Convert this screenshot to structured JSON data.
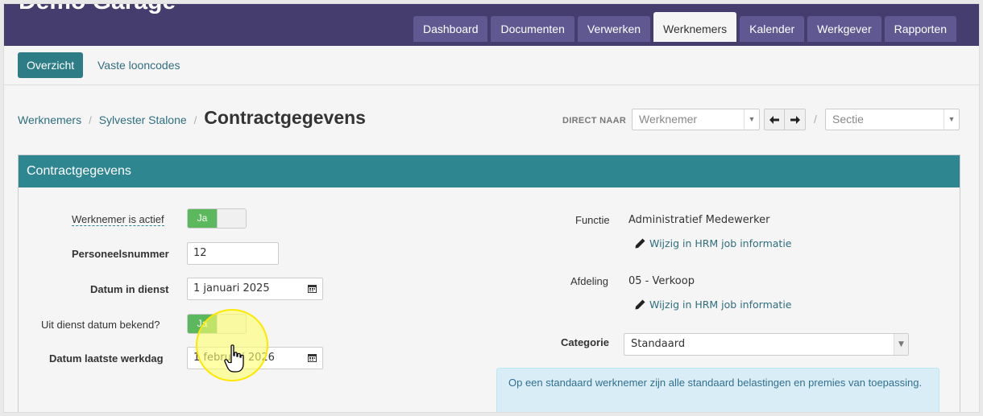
{
  "app": {
    "brand": "Demo Garage"
  },
  "nav": {
    "tabs": [
      {
        "label": "Dashboard"
      },
      {
        "label": "Documenten"
      },
      {
        "label": "Verwerken"
      },
      {
        "label": "Werknemers",
        "active": true
      },
      {
        "label": "Kalender"
      },
      {
        "label": "Werkgever"
      },
      {
        "label": "Rapporten"
      }
    ]
  },
  "subnav": {
    "overview": "Overzicht",
    "fixed_codes": "Vaste looncodes"
  },
  "breadcrumb": {
    "items": [
      "Werknemers",
      "Sylvester Stalone"
    ],
    "separator": "/",
    "title": "Contractgegevens"
  },
  "direct": {
    "label": "DIRECT NAAR",
    "employee_placeholder": "Werknemer",
    "section_placeholder": "Sectie",
    "separator": "/"
  },
  "panel": {
    "title": "Contractgegevens"
  },
  "form": {
    "active_label": "Werknemer is actief",
    "active_value": "Ja",
    "staff_number_label": "Personeelsnummer",
    "staff_number_value": "12",
    "start_date_label": "Datum in dienst",
    "start_date_value": "1 januari 2025",
    "end_known_label": "Uit dienst datum bekend?",
    "end_known_value": "Ja",
    "last_day_label": "Datum laatste werkdag",
    "last_day_value": "1 februari 2026"
  },
  "details": {
    "function_label": "Functie",
    "function_value": "Administratief Medewerker",
    "department_label": "Afdeling",
    "department_value": "05 - Verkoop",
    "edit_link": "Wijzig in HRM job informatie",
    "category_label": "Categorie",
    "category_value": "Standaard",
    "info_text": "Op een standaard werknemer zijn alle standaard belastingen en premies van toepassing."
  },
  "colors": {
    "topbar": "#453d6e",
    "tab": "#605891",
    "accent": "#2e8691",
    "toggle_on": "#5cb85c",
    "info_bg": "#d9edf7"
  }
}
